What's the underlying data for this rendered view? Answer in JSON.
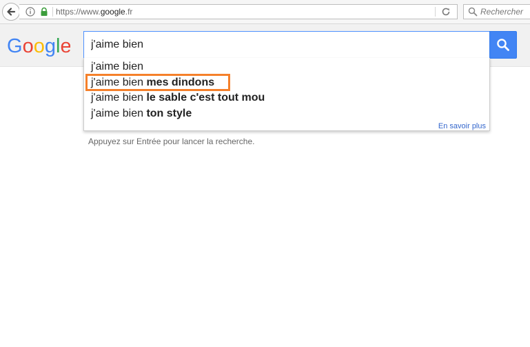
{
  "browser": {
    "url_prefix": "https://www.",
    "url_domain": "google",
    "url_suffix": ".fr",
    "search_placeholder": "Rechercher"
  },
  "google": {
    "logo_letters": [
      "G",
      "o",
      "o",
      "g",
      "l",
      "e"
    ],
    "logo_colors": [
      "#4285f4",
      "#ea4335",
      "#fbbc05",
      "#4285f4",
      "#34a853",
      "#ea4335"
    ],
    "query": "j'aime bien",
    "suggestions": [
      {
        "prefix": "j'aime bien",
        "completion": "",
        "highlighted": false
      },
      {
        "prefix": "j'aime bien",
        "completion": "mes dindons",
        "highlighted": true
      },
      {
        "prefix": "j'aime bien",
        "completion": "le sable c'est tout mou",
        "highlighted": false
      },
      {
        "prefix": "j'aime bien",
        "completion": "ton style",
        "highlighted": false
      }
    ],
    "learn_more": "En savoir plus",
    "hint": "Appuyez sur Entrée pour lancer la recherche."
  },
  "colors": {
    "highlight_border": "#f5802a",
    "search_button": "#4285f4",
    "link": "#3366cc"
  }
}
